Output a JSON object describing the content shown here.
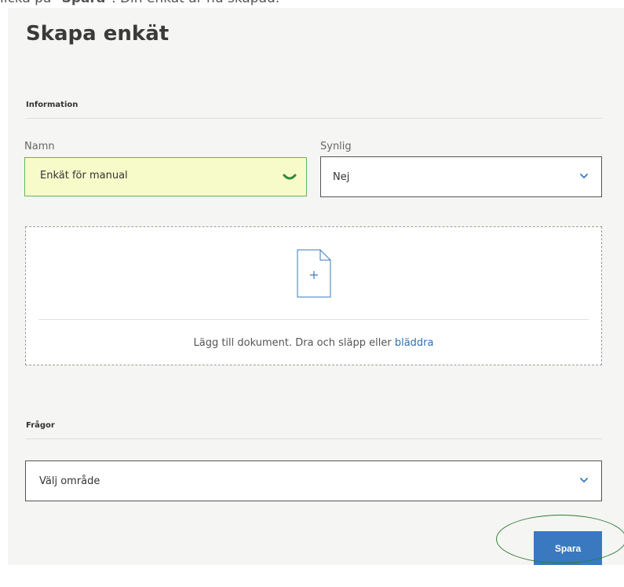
{
  "instruction": {
    "prefix": "licka på \"",
    "bold": "Spara",
    "suffix": "\". Din enkät är nu skapad."
  },
  "form": {
    "title": "Skapa enkät",
    "information_label": "Information",
    "namn": {
      "label": "Namn",
      "value": "Enkät för manual"
    },
    "synlig": {
      "label": "Synlig",
      "value": "Nej"
    },
    "dropzone": {
      "text": "Lägg till dokument. Dra och släpp eller ",
      "link": "bläddra"
    },
    "fragor_label": "Frågor",
    "omrade": {
      "placeholder": "Välj område"
    },
    "save_label": "Spara"
  },
  "colors": {
    "accent": "#3a78c0",
    "valid_green": "#5fb85f",
    "highlight_circle": "#2e7d32",
    "valid_fill": "#f7fbc9"
  }
}
